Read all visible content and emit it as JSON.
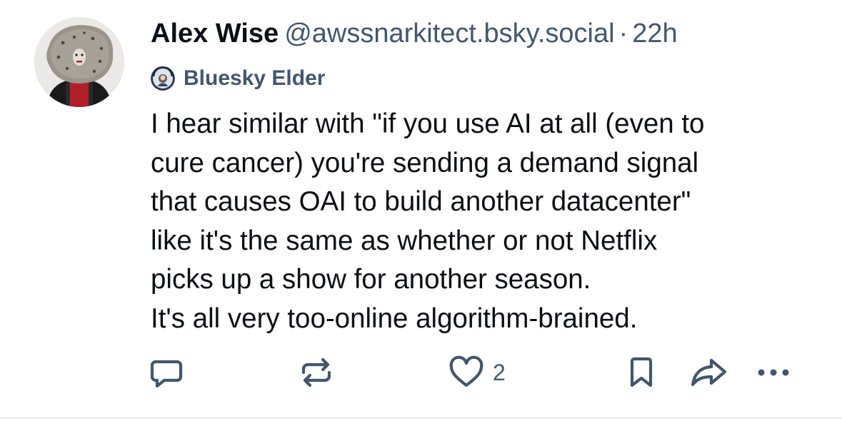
{
  "post": {
    "author": {
      "display_name": "Alex Wise",
      "handle": "@awssnarkitect.bsky.social",
      "separator": "·",
      "timestamp": "22h",
      "avatar_icon": "avatar-photo"
    },
    "badge": {
      "icon": "elder-badge-icon",
      "label": "Bluesky Elder"
    },
    "text_lines": [
      "I hear similar with \"if you use AI at all (even to",
      "cure cancer) you're sending a demand signal",
      "that causes OAI to build another datacenter\"",
      "like it's the same as whether or not Netflix",
      "picks up a show for another season.",
      "It's all very too-online algorithm-brained."
    ],
    "actions": {
      "reply_icon": "reply-icon",
      "repost_icon": "repost-icon",
      "like_icon": "heart-icon",
      "like_count": "2",
      "bookmark_icon": "bookmark-icon",
      "share_icon": "share-icon",
      "more_icon": "more-icon"
    }
  },
  "colors": {
    "text_primary": "#0b0f14",
    "text_secondary": "#42576c",
    "icon": "#42576c",
    "divider": "#e8ebee"
  }
}
